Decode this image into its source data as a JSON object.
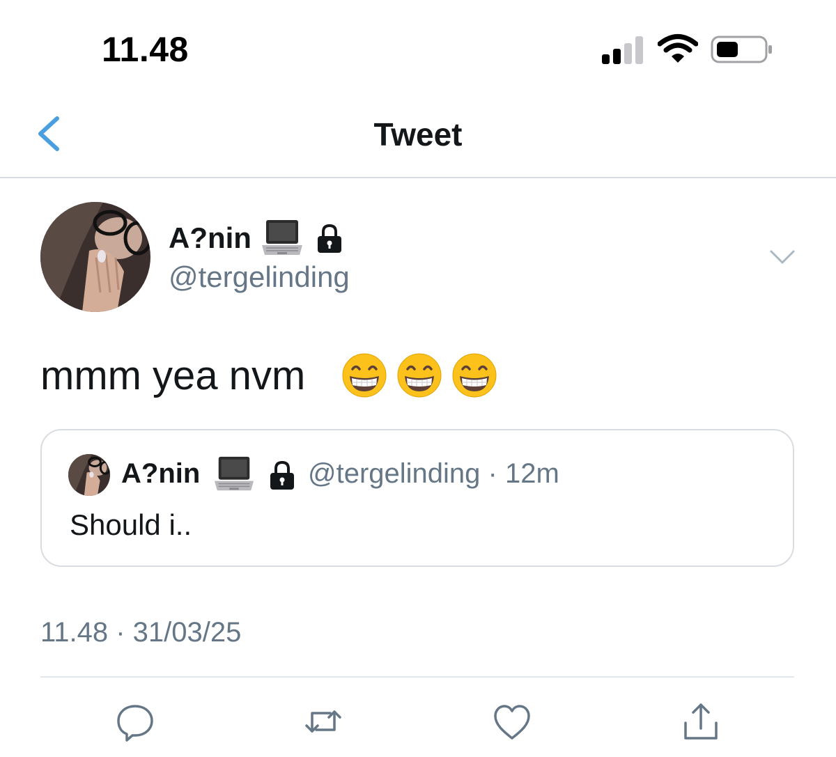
{
  "status_bar": {
    "time": "11.48",
    "icons": [
      "cellular-signal-icon",
      "wifi-icon",
      "battery-icon"
    ]
  },
  "nav": {
    "title": "Tweet",
    "back_icon": "chevron-left-icon"
  },
  "tweet": {
    "author": {
      "display_name": "A?nin",
      "name_emojis": [
        "laptop-emoji",
        "lock-icon"
      ],
      "handle": "@tergelinding"
    },
    "text": "mmm yea nvm",
    "emojis": [
      "grinning-face-emoji",
      "grinning-face-emoji",
      "grinning-face-emoji"
    ],
    "quoted": {
      "display_name": "A?nin",
      "handle_time": "@tergelinding · 12m",
      "text": "Should i.."
    },
    "timestamp": "11.48 · 31/03/25"
  },
  "actions": [
    "reply-icon",
    "retweet-icon",
    "like-icon",
    "share-icon"
  ],
  "colors": {
    "link_blue": "#4a9fe0",
    "text_primary": "#14171a",
    "text_secondary": "#657786",
    "border": "#d9dde1"
  }
}
